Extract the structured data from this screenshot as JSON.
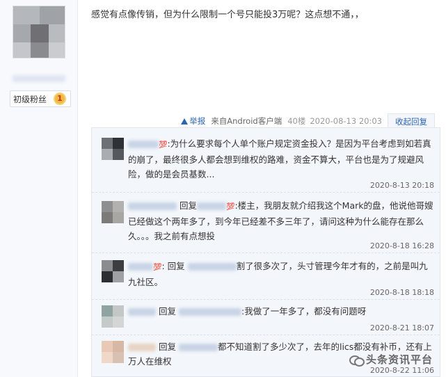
{
  "user": {
    "level_label": "初级粉丝",
    "medal_text": "1"
  },
  "post": {
    "content": "感觉有点像传销，但为什么限制一个号只能投3万呢？这点想不通，，",
    "report_label": "举报",
    "source": "来自Android客户端",
    "floor": "40楼",
    "timestamp": "2020-08-13 20:03",
    "collapse_label": "收起回复"
  },
  "replies": [
    {
      "name_tail": "□",
      "hot": "💯",
      "text": ":为什么要求每个人单个账户规定资金投入？是因为平台考虑到如若真的崩了，最终很多人都会想到维权的路难，资金不算大，平台也是为了规避风险，做的是会员基数...",
      "time": "2020-8-13 20:18"
    },
    {
      "reply_word": "回复",
      "hot": "💯",
      "text": ":楼主，我朋友就介绍我这个Mark的盘，他说他哥嫂已经做这个两年多了，到今年已经差不多三年了，请问这种为什么能存在那么久。。。我之前有点想投",
      "time": "2020-8-18 16:28"
    },
    {
      "hot": "💯",
      "reply_word": "回复",
      "text": "割了很多次了，头寸管理今年才有的，之前是叫九九社区。",
      "time": "2020-8-18 18:18"
    },
    {
      "reply_word": "回复",
      "text": ":我做了一年多了，都没有问题呀",
      "time": "2020-8-21 18:07"
    },
    {
      "reply_word": "回复",
      "text": "都不知道割了多少次了，去年的lics都没有补币，还有上万人在维权",
      "time": "2020-8-22 11:06"
    }
  ],
  "watermark": "头条资讯平台"
}
